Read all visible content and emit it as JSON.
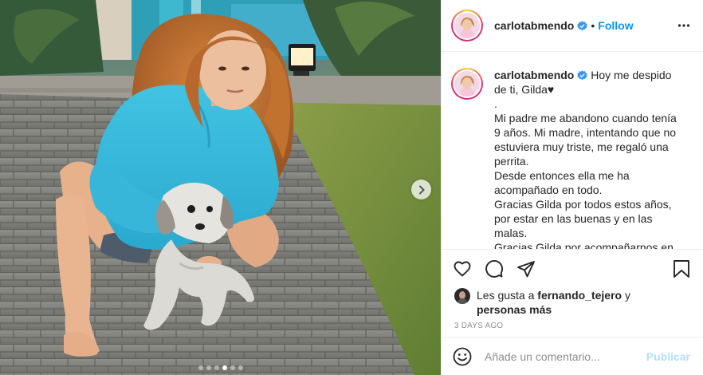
{
  "post": {
    "username": "carlotabmendo",
    "separator": "•",
    "follow_label": "Follow",
    "caption_lines": [
      "Hoy me despido de ti, Gilda♥",
      ".",
      "Mi padre me abandono cuando tenía 9 años. Mi madre, intentando que no estuviera muy triste, me regaló una perrita.",
      "Desde entonces ella me ha acompañado en todo.",
      "Gracias Gilda por todos estos años, por estar en las buenas y en las malas.",
      "Gracias Gilda por acompañarnos en"
    ],
    "likes_prefix": "Les gusta a ",
    "likes_user": "fernando_tejero",
    "likes_middle": " y ",
    "likes_others": "personas más",
    "time_ago": "3 DAYS AGO",
    "comment_placeholder": "Añade un comentario...",
    "publish_label": "Publicar",
    "carousel": {
      "slides": 6,
      "active_index": 3
    }
  },
  "icons": {
    "more": "more-horizontal-icon",
    "verified": "verified-badge-icon",
    "like": "heart-icon",
    "comment": "comment-bubble-icon",
    "share": "paper-plane-icon",
    "save": "bookmark-icon",
    "emoji": "smiley-icon",
    "next": "chevron-right-icon"
  },
  "colors": {
    "accent": "#0095f6",
    "publish_disabled": "#b2dffc",
    "muted": "#8e8e8e",
    "text": "#262626"
  }
}
